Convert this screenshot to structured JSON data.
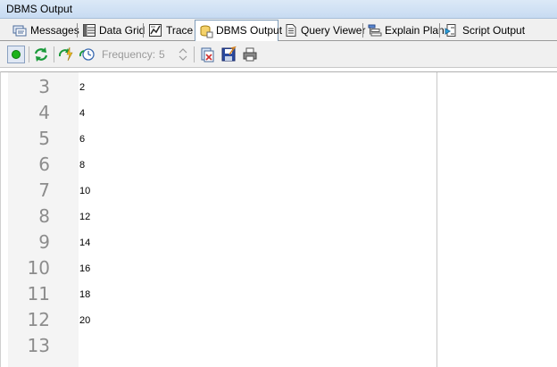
{
  "window": {
    "title": "DBMS Output"
  },
  "tabs": [
    {
      "label": "Messages",
      "icon": "messages-icon",
      "active": false
    },
    {
      "label": "Data Grid",
      "icon": "data-grid-icon",
      "active": false
    },
    {
      "label": "Trace",
      "icon": "trace-icon",
      "active": false
    },
    {
      "label": "DBMS Output",
      "icon": "dbms-output-icon",
      "active": true
    },
    {
      "label": "Query Viewer",
      "icon": "query-viewer-icon",
      "active": false
    },
    {
      "label": "Explain Plan",
      "icon": "explain-plan-icon",
      "active": false
    },
    {
      "label": "Script Output",
      "icon": "script-output-icon",
      "active": false
    }
  ],
  "toolbar": {
    "frequency_label": "Frequency:",
    "frequency_value": "5"
  },
  "output": {
    "lines": [
      {
        "num": "3",
        "text": "2"
      },
      {
        "num": "4",
        "text": "4"
      },
      {
        "num": "5",
        "text": "6"
      },
      {
        "num": "6",
        "text": "8"
      },
      {
        "num": "7",
        "text": "10"
      },
      {
        "num": "8",
        "text": "12"
      },
      {
        "num": "9",
        "text": "14"
      },
      {
        "num": "10",
        "text": "16"
      },
      {
        "num": "11",
        "text": "18"
      },
      {
        "num": "12",
        "text": "20"
      },
      {
        "num": "13",
        "text": ""
      }
    ]
  },
  "colors": {
    "titlebar": "#c7dbf2",
    "gutter_text": "#8c8c8c",
    "status_green": "#1db31d"
  }
}
